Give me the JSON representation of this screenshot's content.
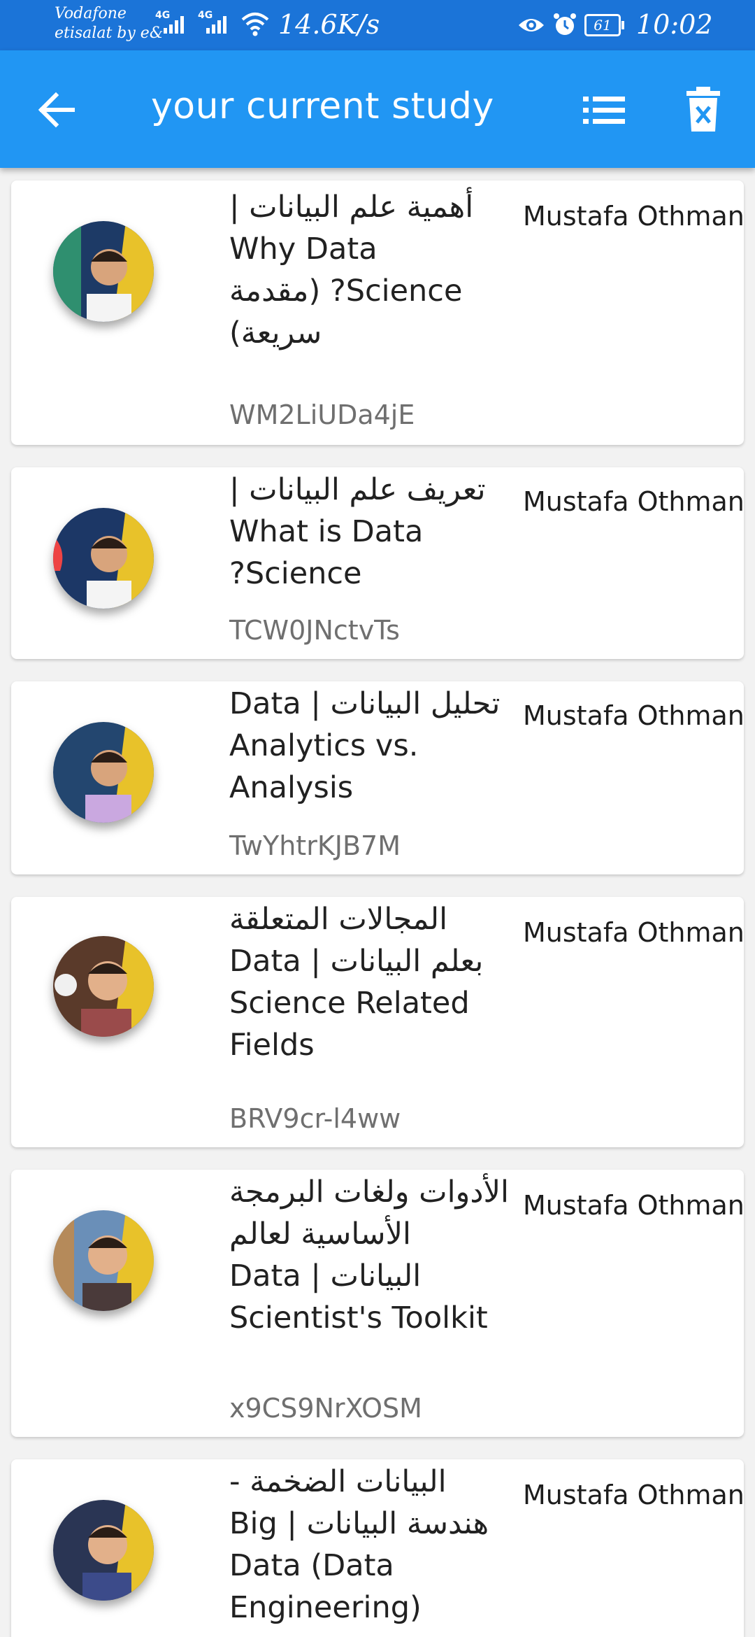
{
  "status_bar": {
    "carrier_line1": "Vodafone",
    "carrier_line2": "etisalat by e&",
    "network1": "4G",
    "network2": "4G",
    "speed": "14.6K/s",
    "battery": "61",
    "time": "10:02"
  },
  "app_bar": {
    "title": "your current study",
    "back_icon": "arrow-left-icon",
    "list_icon": "list-icon",
    "delete_icon": "trash-icon",
    "color": "#2196f3"
  },
  "videos": [
    {
      "title": "أهمية علم البيانات | Why Data Science? (مقدمة سريعة)",
      "id": "WM2LiUDa4jE",
      "author": "Mustafa Othman"
    },
    {
      "title": "تعريف علم البيانات | What is Data Science?",
      "id": "TCW0JNctvTs",
      "author": "Mustafa Othman"
    },
    {
      "title": "تحليل البيانات | Data Analytics vs. Analysis",
      "id": "TwYhtrKJB7M",
      "author": "Mustafa Othman"
    },
    {
      "title": "المجالات المتعلقة بعلم البيانات | Data Science Related Fields",
      "id": "BRV9cr-l4ww",
      "author": "Mustafa Othman"
    },
    {
      "title": "الأدوات ولغات البرمجة الأساسية لعالم البيانات | Data Scientist's Toolkit",
      "id": "x9CS9NrXOSM",
      "author": "Mustafa Othman"
    },
    {
      "title": "البيانات الضخمة - هندسة البيانات | Big Data (Data Engineering)",
      "id": "",
      "author": "Mustafa Othman"
    }
  ]
}
